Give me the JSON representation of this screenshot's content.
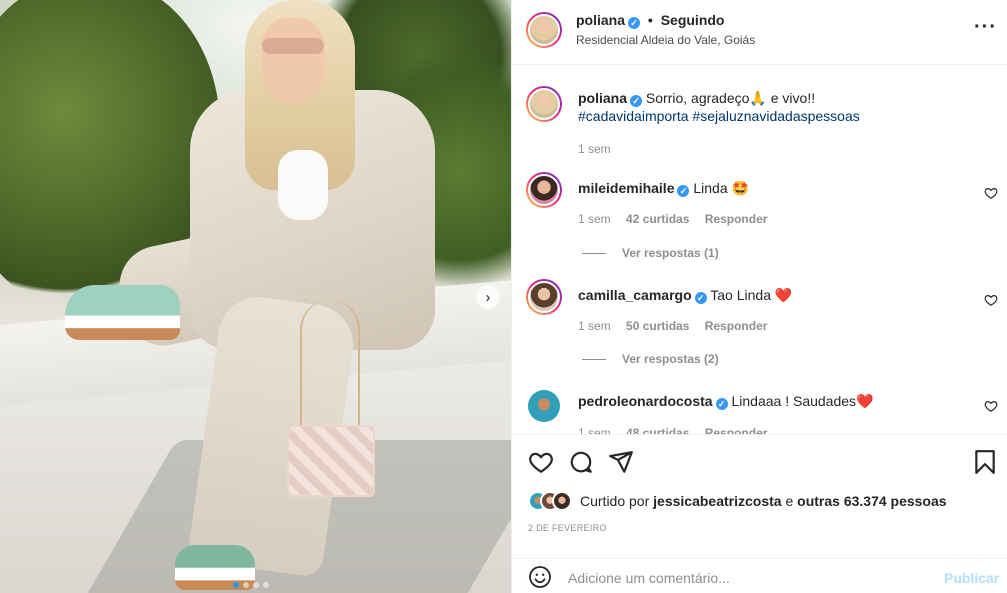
{
  "post": {
    "author": "poliana",
    "follow_state": "Seguindo",
    "location": "Residencial Aldeia do Vale, Goiás",
    "caption_text": "Sorrio, agradeço",
    "caption_emoji": "🙏",
    "caption_tail": "e vivo!!",
    "hashtag_1": "#cadavidaimporta",
    "hashtag_2": "#sejaluznavidadaspessoas",
    "caption_age": "1 sem",
    "date": "2 DE FEVEREIRO",
    "carousel_dots": 4,
    "carousel_active": 1
  },
  "comments": [
    {
      "user": "mileidemihaile",
      "text": "Linda 🤩",
      "age": "1 sem",
      "likes": "42 curtidas",
      "reply": "Responder",
      "view_replies": "Ver respostas (1)"
    },
    {
      "user": "camilla_camargo",
      "text": "Tao Linda ❤️",
      "age": "1 sem",
      "likes": "50 curtidas",
      "reply": "Responder",
      "view_replies": "Ver respostas (2)"
    },
    {
      "user": "pedroleonardocosta",
      "text": "Lindaaa ! Saudades❤️",
      "age": "1 sem",
      "likes": "48 curtidas",
      "reply": "Responder"
    }
  ],
  "likes": {
    "prefix": "Curtido por",
    "user": "jessicabeatrizcosta",
    "connector": "e",
    "others": "outras 63.374 pessoas"
  },
  "add_comment": {
    "placeholder": "Adicione um comentário...",
    "publish": "Publicar"
  },
  "icons": [
    "heart-icon",
    "comment-icon",
    "share-icon",
    "bookmark-icon",
    "emoji-icon",
    "more-icon",
    "verified-icon",
    "chevron-right-icon"
  ],
  "colors": {
    "verified": "#3897f0",
    "hashtag": "#00376b",
    "publish_disabled": "#b2dffc",
    "meta": "#8e8e8e"
  }
}
